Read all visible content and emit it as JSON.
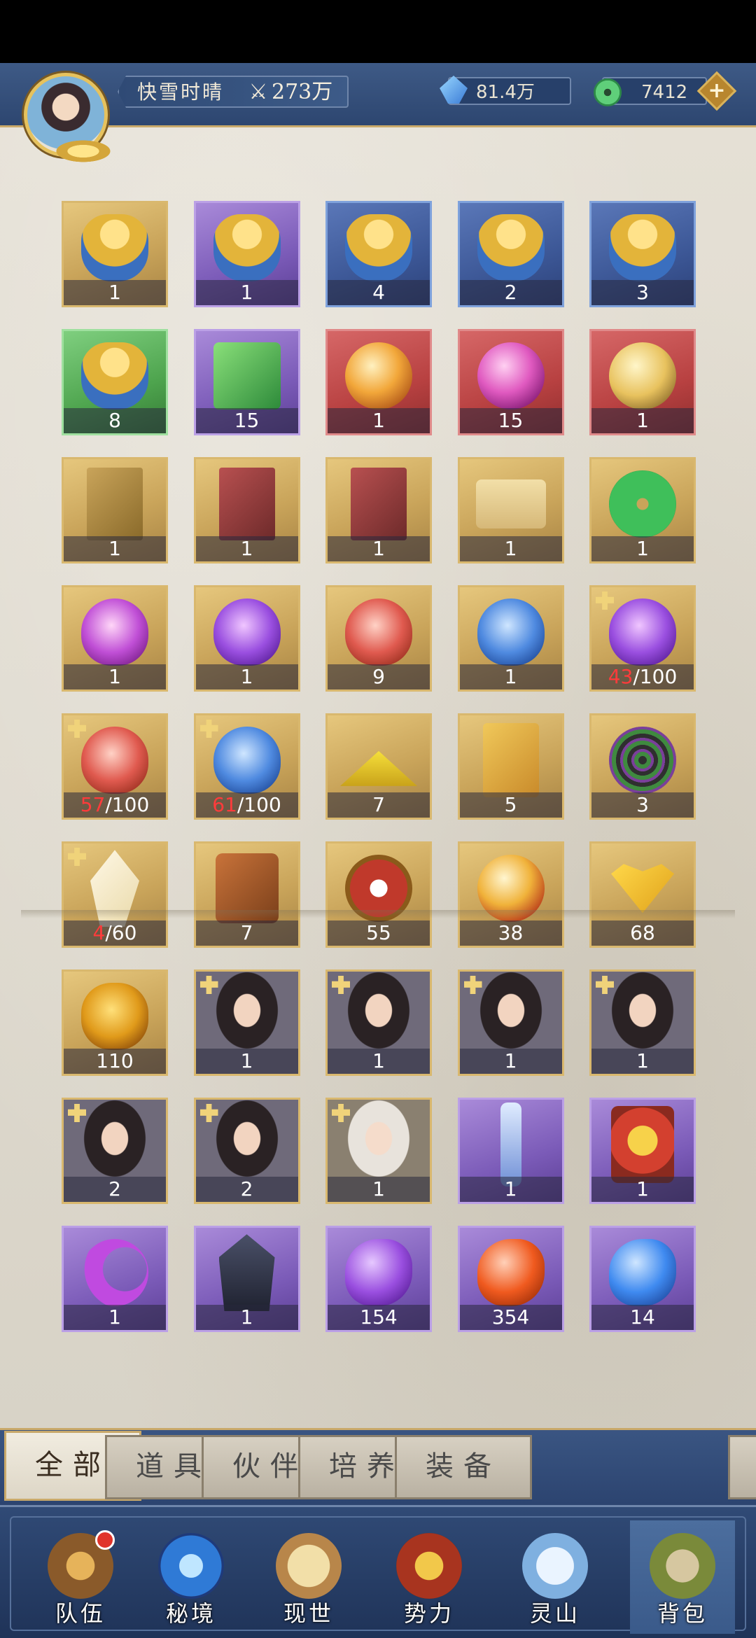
{
  "header": {
    "player_name": "快雪时晴",
    "power_value": "273万",
    "crystals": "81.4万",
    "jade": "7412",
    "plus": "+",
    "power_icon_glyph": "⚔"
  },
  "inventory": {
    "items": [
      {
        "name": "pouch",
        "rarity": "gold",
        "art": "art-pouch",
        "count": "1"
      },
      {
        "name": "pouch",
        "rarity": "purple",
        "art": "art-pouch",
        "count": "1"
      },
      {
        "name": "pouch",
        "rarity": "blue",
        "art": "art-pouch",
        "count": "4"
      },
      {
        "name": "pouch",
        "rarity": "blue",
        "art": "art-pouch",
        "count": "2"
      },
      {
        "name": "pouch",
        "rarity": "blue",
        "art": "art-pouch",
        "count": "3"
      },
      {
        "name": "pouch",
        "rarity": "green",
        "art": "art-pouch",
        "count": "8"
      },
      {
        "name": "jade-box",
        "rarity": "purple",
        "art": "art-box",
        "count": "15"
      },
      {
        "name": "fire-orb",
        "rarity": "red",
        "art": "art-orb",
        "count": "1"
      },
      {
        "name": "pink-orb",
        "rarity": "red",
        "art": "art-orb-pink",
        "count": "15"
      },
      {
        "name": "golden-sphere",
        "rarity": "red",
        "art": "art-sphere",
        "count": "1"
      },
      {
        "name": "manual",
        "rarity": "gold",
        "art": "art-book",
        "count": "1"
      },
      {
        "name": "zhetian-book",
        "rarity": "gold",
        "art": "art-book-red",
        "count": "1"
      },
      {
        "name": "zhetian-book",
        "rarity": "gold",
        "art": "art-book-red",
        "count": "1"
      },
      {
        "name": "scroll",
        "rarity": "gold",
        "art": "art-scroll",
        "count": "1"
      },
      {
        "name": "jade-pendant",
        "rarity": "gold",
        "art": "art-jade",
        "count": "1"
      },
      {
        "name": "pink-spirit",
        "rarity": "gold",
        "art": "art-flame-pink",
        "count": "1"
      },
      {
        "name": "purple-spirit",
        "rarity": "gold",
        "art": "art-flame-purple",
        "count": "1"
      },
      {
        "name": "red-spirit",
        "rarity": "gold",
        "art": "art-flame-red",
        "count": "9"
      },
      {
        "name": "blue-spirit",
        "rarity": "gold",
        "art": "art-flame-blue",
        "count": "1"
      },
      {
        "name": "purple-spirit-fragment",
        "rarity": "gold",
        "art": "art-flame-purple",
        "have": "43",
        "need": "/100",
        "fragment": true
      },
      {
        "name": "red-spirit-fragment",
        "rarity": "gold",
        "art": "art-flame-red",
        "have": "57",
        "need": "/100",
        "fragment": true
      },
      {
        "name": "blue-spirit-fragment",
        "rarity": "gold",
        "art": "art-flame-blue",
        "have": "61",
        "need": "/100",
        "fragment": true
      },
      {
        "name": "golden-powder",
        "rarity": "gold",
        "art": "art-powder",
        "count": "7"
      },
      {
        "name": "scroll-bundle",
        "rarity": "gold",
        "art": "art-scrolls",
        "count": "5"
      },
      {
        "name": "spirit-disc",
        "rarity": "gold",
        "art": "art-target",
        "count": "3"
      },
      {
        "name": "crystal-fragment",
        "rarity": "gold",
        "art": "art-crystal",
        "have": "4",
        "need": "/60",
        "fragment": true
      },
      {
        "name": "arrow-quiver",
        "rarity": "gold",
        "art": "art-arrows",
        "count": "7"
      },
      {
        "name": "seal-token",
        "rarity": "gold",
        "art": "art-seal",
        "count": "55"
      },
      {
        "name": "spirit-pearl",
        "rarity": "gold",
        "art": "art-pearl",
        "count": "38"
      },
      {
        "name": "ginkgo-leaf",
        "rarity": "gold",
        "art": "art-leaf",
        "count": "68"
      },
      {
        "name": "amber-stone",
        "rarity": "gold",
        "art": "art-amber",
        "count": "110"
      },
      {
        "name": "hero-portrait",
        "rarity": "gold",
        "art": "art-portrait",
        "count": "1",
        "fragment": true
      },
      {
        "name": "hero-portrait",
        "rarity": "gold",
        "art": "art-portrait",
        "count": "1",
        "fragment": true
      },
      {
        "name": "hero-portrait",
        "rarity": "gold",
        "art": "art-portrait",
        "count": "1",
        "fragment": true
      },
      {
        "name": "hero-portrait",
        "rarity": "gold",
        "art": "art-portrait",
        "count": "1",
        "fragment": true
      },
      {
        "name": "hero-portrait",
        "rarity": "gold",
        "art": "art-portrait",
        "count": "2",
        "fragment": true
      },
      {
        "name": "hero-portrait",
        "rarity": "gold",
        "art": "art-portrait",
        "count": "2",
        "fragment": true
      },
      {
        "name": "hero-portrait",
        "rarity": "gold",
        "art": "art-portrait light",
        "count": "1",
        "fragment": true
      },
      {
        "name": "spirit-sword",
        "rarity": "purple",
        "art": "art-sword",
        "count": "1"
      },
      {
        "name": "fire-charm",
        "rarity": "purple",
        "art": "art-charm",
        "count": "1"
      },
      {
        "name": "moon-blade",
        "rarity": "purple",
        "art": "art-moon",
        "count": "1"
      },
      {
        "name": "dark-cloak",
        "rarity": "purple",
        "art": "art-cloak",
        "count": "1"
      },
      {
        "name": "purple-gem",
        "rarity": "purple",
        "art": "art-gem-purple",
        "count": "154"
      },
      {
        "name": "red-gem",
        "rarity": "purple",
        "art": "art-gem-red",
        "count": "354"
      },
      {
        "name": "blue-gem",
        "rarity": "purple",
        "art": "art-gem-blue",
        "count": "14"
      }
    ]
  },
  "tabs": [
    {
      "id": "all",
      "label": "全部",
      "active": true
    },
    {
      "id": "props",
      "label": "道具",
      "active": false
    },
    {
      "id": "partners",
      "label": "伙伴",
      "active": false
    },
    {
      "id": "cultivate",
      "label": "培养",
      "active": false
    },
    {
      "id": "equipment",
      "label": "装备",
      "active": false
    }
  ],
  "nav": [
    {
      "id": "team",
      "label": "队伍",
      "badge": true
    },
    {
      "id": "secret-realm",
      "label": "秘境",
      "badge": false
    },
    {
      "id": "world",
      "label": "现世",
      "badge": false
    },
    {
      "id": "faction",
      "label": "势力",
      "badge": false
    },
    {
      "id": "spirit-mountain",
      "label": "灵山",
      "badge": false
    },
    {
      "id": "backpack",
      "label": "背包",
      "badge": false,
      "active": true
    }
  ],
  "colors": {
    "accent_gold": "#c9a96a",
    "header_blue": "#2d4670",
    "fragment_red": "#ff3b3b"
  }
}
